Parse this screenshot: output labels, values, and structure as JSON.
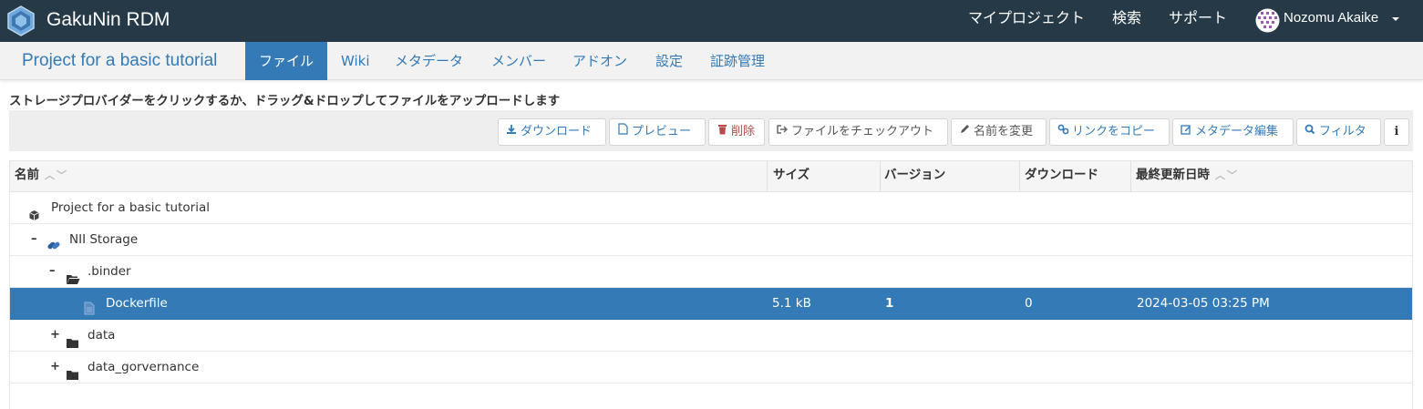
{
  "app": {
    "name": "GakuNin RDM"
  },
  "topnav": {
    "my_projects": "マイプロジェクト",
    "search": "検索",
    "support": "サポート",
    "user_name": "Nozomu Akaike"
  },
  "project": {
    "title": "Project for a basic tutorial",
    "tabs": [
      "ファイル",
      "Wiki",
      "メタデータ",
      "メンバー",
      "アドオン",
      "設定",
      "証跡管理"
    ],
    "active_tab": "ファイル"
  },
  "instructions": "ストレージプロバイダーをクリックするか、ドラッグ&ドロップしてファイルをアップロードします",
  "toolbar": {
    "download": "ダウンロード",
    "preview": "プレビュー",
    "delete": "削除",
    "checkout": "ファイルをチェックアウト",
    "rename": "名前を変更",
    "copy_link": "リンクをコピー",
    "edit_metadata": "メタデータ編集",
    "filter": "フィルタ",
    "info": "i"
  },
  "grid": {
    "columns": {
      "name": "名前",
      "size": "サイズ",
      "version": "バージョン",
      "downloads": "ダウンロード",
      "modified": "最終更新日時"
    },
    "rows": [
      {
        "name": "Project for a basic tutorial",
        "toggle": "",
        "icon": "cube-icon"
      },
      {
        "name": "NII Storage",
        "toggle": "–",
        "icon": "link-icon"
      },
      {
        "name": ".binder",
        "toggle": "–",
        "icon": "folder-open-icon"
      },
      {
        "name": "Dockerfile",
        "toggle": "",
        "icon": "file-icon",
        "size": "5.1 kB",
        "version": "1",
        "downloads": "0",
        "modified": "2024-03-05 03:25 PM",
        "selected": true
      },
      {
        "name": "data",
        "toggle": "+",
        "icon": "folder-icon"
      },
      {
        "name": "data_gorvernance",
        "toggle": "+",
        "icon": "folder-icon"
      }
    ]
  },
  "colors": {
    "navbar": "#263947",
    "accent": "#337ab7",
    "danger": "#b94a48"
  }
}
